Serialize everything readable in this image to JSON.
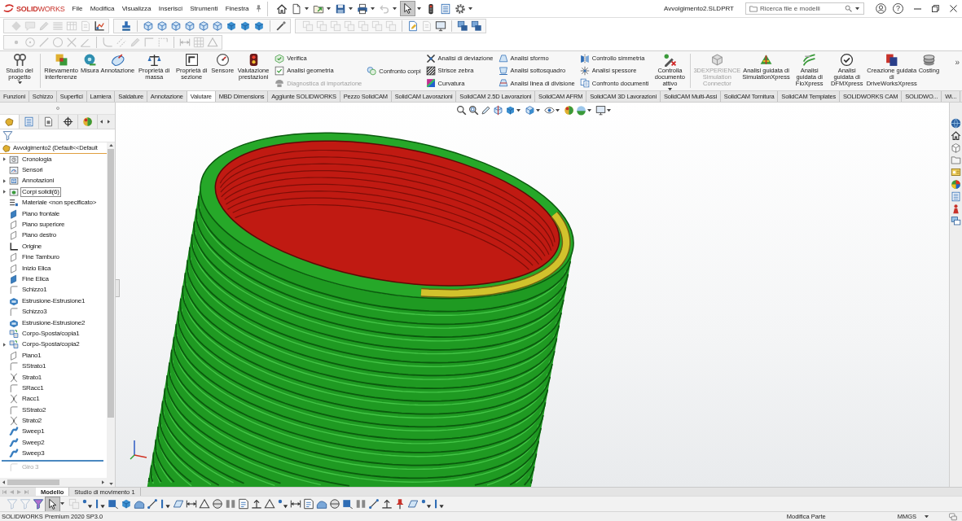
{
  "title_bar": {
    "logo": "**SOLID**WORKS",
    "menu": [
      "File",
      "Modifica",
      "Visualizza",
      "Inserisci",
      "Strumenti",
      "Finestra"
    ],
    "quick_access": [
      {
        "kind": "home",
        "menu": false,
        "disabled": false,
        "pressed": false
      },
      {
        "kind": "new",
        "menu": true,
        "disabled": false,
        "pressed": false
      },
      {
        "kind": "open",
        "menu": true,
        "disabled": false,
        "pressed": false
      },
      {
        "kind": "save",
        "menu": true,
        "disabled": false,
        "pressed": false
      },
      {
        "kind": "print",
        "menu": true,
        "disabled": false,
        "pressed": false
      },
      {
        "kind": "undo",
        "menu": true,
        "disabled": true,
        "pressed": false
      },
      {
        "kind": "select",
        "menu": true,
        "disabled": false,
        "pressed": true
      },
      {
        "kind": "rebuild",
        "menu": false,
        "disabled": false,
        "pressed": false
      },
      {
        "kind": "file-properties",
        "menu": false,
        "disabled": false,
        "pressed": false
      },
      {
        "kind": "options",
        "menu": true,
        "disabled": false,
        "pressed": false
      }
    ],
    "document_title": "Avvolgimento2.SLDPRT",
    "search": {
      "placeholder": "Ricerca file e modelli"
    },
    "help": "?"
  },
  "toolbars": [
    [
      {
        "sections": [
          [
            {
              "kind": "diamond",
              "disabled": true
            },
            {
              "kind": "comment",
              "disabled": true
            },
            {
              "kind": "pencil",
              "disabled": true
            },
            {
              "kind": "lines",
              "disabled": true
            },
            {
              "kind": "table",
              "disabled": true
            },
            {
              "kind": "page",
              "disabled": true
            },
            {
              "kind": "axes",
              "disabled": false
            }
          ]
        ]
      },
      {
        "sections": [
          [
            {
              "kind": "stamp",
              "disabled": false
            }
          ],
          [
            {
              "kind": "cube-wire",
              "disabled": false
            },
            {
              "kind": "cube-wire",
              "disabled": false
            },
            {
              "kind": "cube-wire",
              "disabled": false
            },
            {
              "kind": "cube-wire",
              "disabled": false
            },
            {
              "kind": "cube-wire",
              "disabled": false
            },
            {
              "kind": "cube-wire",
              "disabled": false
            },
            {
              "kind": "cube",
              "disabled": false
            },
            {
              "kind": "cube",
              "disabled": false
            },
            {
              "kind": "cube",
              "disabled": false
            }
          ],
          [
            {
              "kind": "wand",
              "disabled": false
            }
          ]
        ]
      },
      {
        "sections": [
          [
            {
              "kind": "squares",
              "disabled": true
            },
            {
              "kind": "squares",
              "disabled": true
            },
            {
              "kind": "squares",
              "disabled": true
            },
            {
              "kind": "squares",
              "disabled": true
            },
            {
              "kind": "squares",
              "disabled": true
            },
            {
              "kind": "squares",
              "disabled": true
            },
            {
              "kind": "squares",
              "disabled": true
            }
          ],
          [
            {
              "kind": "doc-edit",
              "disabled": false
            },
            {
              "kind": "page",
              "disabled": true
            },
            {
              "kind": "monitor",
              "disabled": false
            }
          ],
          [
            {
              "kind": "windows",
              "disabled": false
            },
            {
              "kind": "windows",
              "disabled": false
            }
          ]
        ]
      }
    ],
    [
      {
        "sections": [
          [
            {
              "kind": "point",
              "disabled": true
            },
            {
              "kind": "circle-target",
              "disabled": true
            },
            {
              "kind": "line",
              "disabled": true
            },
            {
              "kind": "circle",
              "disabled": true
            },
            {
              "kind": "trim",
              "disabled": true
            },
            {
              "kind": "angle-line",
              "disabled": true
            }
          ],
          [
            {
              "kind": "fillet",
              "disabled": true
            },
            {
              "kind": "offset",
              "disabled": true
            },
            {
              "kind": "pencil",
              "disabled": true
            },
            {
              "kind": "corner",
              "disabled": true
            },
            {
              "kind": "corner-dashed",
              "disabled": true
            }
          ],
          [
            {
              "kind": "dimension",
              "disabled": true
            },
            {
              "kind": "grid",
              "disabled": true
            },
            {
              "kind": "triangle",
              "disabled": true
            }
          ]
        ]
      }
    ]
  ],
  "ribbon": {
    "groups": [
      [
        {
          "kind": "large",
          "item": {
            "kind": "tools",
            "label": "Studio del progetto",
            "menu": true,
            "disabled": false
          }
        }
      ],
      [
        {
          "kind": "large",
          "item": {
            "kind": "interference",
            "label": "Rilevamento interferenze",
            "menu": false,
            "disabled": false
          }
        },
        {
          "kind": "large",
          "item": {
            "kind": "measure",
            "label": "Misura",
            "menu": false,
            "disabled": false
          }
        },
        {
          "kind": "large",
          "item": {
            "kind": "annotation",
            "label": "Annotazione",
            "menu": false,
            "disabled": false
          }
        },
        {
          "kind": "large",
          "item": {
            "kind": "mass-properties",
            "label": "Proprietà di massa",
            "menu": false,
            "disabled": false
          }
        },
        {
          "kind": "large",
          "item": {
            "kind": "section-properties",
            "label": "Proprietà di sezione",
            "menu": false,
            "disabled": false
          }
        },
        {
          "kind": "large",
          "item": {
            "kind": "sensor",
            "label": "Sensore",
            "menu": false,
            "disabled": false
          }
        },
        {
          "kind": "large",
          "item": {
            "kind": "performance",
            "label": "Valutazione prestazioni",
            "menu": false,
            "disabled": false
          }
        },
        {
          "kind": "stack",
          "items": [
            {
              "kind": "verify",
              "label": "Verifica",
              "disabled": false
            },
            {
              "kind": "geometry",
              "label": "Analisi geometria",
              "disabled": false
            },
            {
              "kind": "import-diagnostics",
              "label": "Diagnostica di importazione",
              "disabled": true
            }
          ]
        },
        {
          "kind": "stack",
          "items": [
            {
              "kind": "compare-bodies",
              "label": "Confronto corpi",
              "disabled": false
            }
          ]
        },
        {
          "kind": "stack",
          "items": [
            {
              "kind": "deviation",
              "label": "Analisi di deviazione",
              "disabled": false
            },
            {
              "kind": "zebra",
              "label": "Strisce zebra",
              "disabled": false
            },
            {
              "kind": "curvature",
              "label": "Curvatura",
              "disabled": false
            }
          ]
        },
        {
          "kind": "stack",
          "items": [
            {
              "kind": "draft",
              "label": "Analisi sformo",
              "disabled": false
            },
            {
              "kind": "undercut",
              "label": "Analisi sottosquadro",
              "disabled": false
            },
            {
              "kind": "parting-line",
              "label": "Analisi linea di divisione",
              "disabled": false
            }
          ]
        },
        {
          "kind": "stack",
          "items": [
            {
              "kind": "symmetry",
              "label": "Controllo simmetria",
              "disabled": false
            },
            {
              "kind": "thickness",
              "label": "Analisi spessore",
              "disabled": false
            },
            {
              "kind": "compare-documents",
              "label": "Confronto documenti",
              "disabled": false
            }
          ]
        },
        {
          "kind": "large",
          "item": {
            "kind": "design-checker",
            "label": "Controlla documento attivo",
            "menu": true,
            "disabled": false
          }
        }
      ],
      [
        {
          "kind": "large",
          "item": {
            "kind": "connector",
            "label": "3DEXPERIENCE Simulation Connector",
            "menu": false,
            "disabled": true
          }
        },
        {
          "kind": "large",
          "item": {
            "kind": "simulationxpress",
            "label": "Analisi guidata di SimulationXpress",
            "menu": false,
            "disabled": false
          }
        },
        {
          "kind": "large",
          "item": {
            "kind": "floxpress",
            "label": "Analisi guidata di FloXpress",
            "menu": false,
            "disabled": false
          }
        },
        {
          "kind": "large",
          "item": {
            "kind": "dfmxpress",
            "label": "Analisi guidata di DFMXpress",
            "menu": false,
            "disabled": false
          }
        },
        {
          "kind": "large",
          "item": {
            "kind": "driveworksxpress",
            "label": "Creazione guidata di DriveWorksXpress",
            "menu": false,
            "disabled": false
          }
        },
        {
          "kind": "large",
          "item": {
            "kind": "costing",
            "label": "Costing",
            "menu": false,
            "disabled": false
          }
        }
      ]
    ],
    "more": "»"
  },
  "command_tabs": [
    {
      "label": "Funzioni",
      "selected": false
    },
    {
      "label": "Schizzo",
      "selected": false
    },
    {
      "label": "Superfici",
      "selected": false
    },
    {
      "label": "Lamiera",
      "selected": false
    },
    {
      "label": "Saldature",
      "selected": false
    },
    {
      "label": "Annotazione",
      "selected": false
    },
    {
      "label": "Valutare",
      "selected": true
    },
    {
      "label": "MBD Dimensions",
      "selected": false
    },
    {
      "label": "Aggiunte SOLIDWORKS",
      "selected": false
    },
    {
      "label": "Pezzo SolidCAM",
      "selected": false
    },
    {
      "label": "SolidCAM Lavorazioni",
      "selected": false
    },
    {
      "label": "SolidCAM 2.5D Lavorazioni",
      "selected": false
    },
    {
      "label": "SolidCAM AFRM",
      "selected": false
    },
    {
      "label": "SolidCAM 3D Lavorazioni",
      "selected": false
    },
    {
      "label": "SolidCAM Multi-Assi",
      "selected": false
    },
    {
      "label": "SolidCAM Tornitura",
      "selected": false
    },
    {
      "label": "SolidCAM Templates",
      "selected": false
    },
    {
      "label": "SOLIDWORKS CAM",
      "selected": false
    },
    {
      "label": "SOLIDWO...",
      "selected": false
    },
    {
      "label": "Wi...",
      "selected": false
    }
  ],
  "feature_tree": {
    "tabs": [
      {
        "kind": "feature-manager",
        "selected": true
      },
      {
        "kind": "property-manager",
        "selected": false
      },
      {
        "kind": "configuration-manager",
        "selected": false
      },
      {
        "kind": "dimxpert",
        "selected": false
      },
      {
        "kind": "display-manager",
        "selected": false
      }
    ],
    "root": "Avvolgimento2 (Default<<Default",
    "items": [
      {
        "kind": "history",
        "label": "Cronologia",
        "expandable": true,
        "selected": false,
        "rolled_back": false
      },
      {
        "kind": "sensors",
        "label": "Sensori",
        "expandable": false,
        "selected": false,
        "rolled_back": false
      },
      {
        "kind": "annotations",
        "label": "Annotazioni",
        "expandable": true,
        "selected": false,
        "rolled_back": false
      },
      {
        "kind": "bodies",
        "label": "Corpi solidi(6)",
        "expandable": true,
        "selected": true,
        "rolled_back": false
      },
      {
        "kind": "material",
        "label": "Materiale <non specificato>",
        "expandable": false,
        "selected": false,
        "rolled_back": false
      },
      {
        "kind": "plane-filled",
        "label": "Piano frontale",
        "expandable": false,
        "selected": false,
        "rolled_back": false
      },
      {
        "kind": "plane",
        "label": "Piano superiore",
        "expandable": false,
        "selected": false,
        "rolled_back": false
      },
      {
        "kind": "plane",
        "label": "Piano destro",
        "expandable": false,
        "selected": false,
        "rolled_back": false
      },
      {
        "kind": "origin",
        "label": "Origine",
        "expandable": false,
        "selected": false,
        "rolled_back": false
      },
      {
        "kind": "plane",
        "label": "Fine Tamburo",
        "expandable": false,
        "selected": false,
        "rolled_back": false
      },
      {
        "kind": "plane",
        "label": "Inizio Elica",
        "expandable": false,
        "selected": false,
        "rolled_back": false
      },
      {
        "kind": "plane-filled",
        "label": "Fine Elica",
        "expandable": false,
        "selected": false,
        "rolled_back": false
      },
      {
        "kind": "sketch",
        "label": "Schizzo1",
        "expandable": false,
        "selected": false,
        "rolled_back": false
      },
      {
        "kind": "extrude",
        "label": "Estrusione-Estrusione1",
        "expandable": false,
        "selected": false,
        "rolled_back": false
      },
      {
        "kind": "sketch",
        "label": "Schizzo3",
        "expandable": false,
        "selected": false,
        "rolled_back": false
      },
      {
        "kind": "extrude",
        "label": "Estrusione-Estrusione2",
        "expandable": false,
        "selected": false,
        "rolled_back": false
      },
      {
        "kind": "move-body",
        "label": "Corpo-Sposta/copia1",
        "expandable": false,
        "selected": false,
        "rolled_back": false
      },
      {
        "kind": "move-body",
        "label": "Corpo-Sposta/copia2",
        "expandable": true,
        "selected": false,
        "rolled_back": false
      },
      {
        "kind": "plane",
        "label": "Piano1",
        "expandable": false,
        "selected": false,
        "rolled_back": false
      },
      {
        "kind": "sketch",
        "label": "SStrato1",
        "expandable": false,
        "selected": false,
        "rolled_back": false
      },
      {
        "kind": "loft",
        "label": "Strato1",
        "expandable": false,
        "selected": false,
        "rolled_back": false
      },
      {
        "kind": "sketch",
        "label": "SRacc1",
        "expandable": false,
        "selected": false,
        "rolled_back": false
      },
      {
        "kind": "loft",
        "label": "Racc1",
        "expandable": false,
        "selected": false,
        "rolled_back": false
      },
      {
        "kind": "sketch",
        "label": "SStrato2",
        "expandable": false,
        "selected": false,
        "rolled_back": false
      },
      {
        "kind": "loft",
        "label": "Strato2",
        "expandable": false,
        "selected": false,
        "rolled_back": false
      },
      {
        "kind": "sweep",
        "label": "Sweep1",
        "expandable": false,
        "selected": false,
        "rolled_back": false
      },
      {
        "kind": "sweep",
        "label": "Sweep2",
        "expandable": false,
        "selected": false,
        "rolled_back": false
      },
      {
        "kind": "sweep",
        "label": "Sweep3",
        "expandable": false,
        "selected": false,
        "rolled_back": false
      },
      {
        "kind": "sketch",
        "label": "Giro 3",
        "expandable": false,
        "selected": false,
        "rolled_back": true
      }
    ]
  },
  "view_toolbar": [
    {
      "kind": "zoom-fit",
      "menu": false
    },
    {
      "kind": "zoom-area",
      "menu": false
    },
    {
      "kind": "previous-view",
      "menu": false
    },
    {
      "kind": "section-view",
      "menu": false
    },
    {
      "kind": "view-orientation",
      "menu": true
    },
    {
      "kind": "display-style",
      "menu": true
    },
    {
      "kind": "hide-show",
      "menu": true
    },
    {
      "kind": "appearance",
      "menu": false
    },
    {
      "kind": "scene",
      "menu": true
    },
    {
      "kind": "view-settings",
      "menu": true
    }
  ],
  "task_pane": [
    {
      "kind": "globe"
    },
    {
      "kind": "home"
    },
    {
      "kind": "box"
    },
    {
      "kind": "folder"
    },
    {
      "kind": "card"
    },
    {
      "kind": "color-wheel"
    },
    {
      "kind": "list"
    },
    {
      "kind": "figure"
    },
    {
      "kind": "chat"
    }
  ],
  "bottom_tabs": [
    {
      "label": "Modello",
      "selected": true
    },
    {
      "label": "Studio di movimento 1",
      "selected": false
    }
  ],
  "selection_toolbar": [
    {
      "kind": "filter",
      "disabled": true,
      "pressed": false,
      "menu": false
    },
    {
      "kind": "filter",
      "disabled": true,
      "pressed": false,
      "menu": false
    },
    {
      "kind": "filter-color",
      "disabled": false,
      "pressed": false,
      "menu": false
    },
    {
      "kind": "select",
      "disabled": false,
      "pressed": true,
      "menu": true
    },
    {
      "kind": "squares",
      "disabled": true,
      "pressed": false,
      "menu": false
    },
    {
      "kind": "sel-point",
      "disabled": false,
      "pressed": false,
      "menu": false
    },
    {
      "kind": "sel-edge",
      "disabled": false,
      "pressed": false,
      "menu": false
    },
    {
      "kind": "sel-face",
      "disabled": false,
      "pressed": false,
      "menu": false
    },
    {
      "kind": "cube",
      "disabled": false,
      "pressed": false,
      "menu": false
    },
    {
      "kind": "sel-surface",
      "disabled": false,
      "pressed": false,
      "menu": false
    },
    {
      "kind": "sel-segment",
      "disabled": false,
      "pressed": false,
      "menu": false
    },
    {
      "kind": "sel-edge",
      "disabled": false,
      "pressed": false,
      "menu": false
    },
    {
      "kind": "sel-plane",
      "disabled": false,
      "pressed": false,
      "menu": false
    },
    {
      "kind": "dimension",
      "disabled": false,
      "pressed": false,
      "menu": false
    },
    {
      "kind": "triangle",
      "disabled": false,
      "pressed": false,
      "menu": false
    },
    {
      "kind": "sel-split",
      "disabled": false,
      "pressed": false,
      "menu": false
    },
    {
      "kind": "sel-bars",
      "disabled": false,
      "pressed": false,
      "menu": false
    },
    {
      "kind": "note",
      "disabled": false,
      "pressed": false,
      "menu": false
    },
    {
      "kind": "sel-weld",
      "disabled": false,
      "pressed": false,
      "menu": false
    },
    {
      "kind": "triangle",
      "disabled": false,
      "pressed": false,
      "menu": false
    },
    {
      "kind": "sel-point",
      "disabled": false,
      "pressed": false,
      "menu": false
    },
    {
      "kind": "dimension",
      "disabled": false,
      "pressed": false,
      "menu": false
    },
    {
      "kind": "note",
      "disabled": false,
      "pressed": false,
      "menu": false
    },
    {
      "kind": "sel-surface",
      "disabled": false,
      "pressed": false,
      "menu": false
    },
    {
      "kind": "sel-split",
      "disabled": false,
      "pressed": false,
      "menu": false
    },
    {
      "kind": "sel-face",
      "disabled": false,
      "pressed": false,
      "menu": false
    },
    {
      "kind": "sel-bars",
      "disabled": false,
      "pressed": false,
      "menu": false
    },
    {
      "kind": "sel-segment",
      "disabled": false,
      "pressed": false,
      "menu": false
    },
    {
      "kind": "sel-weld",
      "disabled": false,
      "pressed": false,
      "menu": false
    },
    {
      "kind": "sel-pin",
      "disabled": false,
      "pressed": false,
      "menu": false
    },
    {
      "kind": "sel-plane",
      "disabled": false,
      "pressed": false,
      "menu": false
    },
    {
      "kind": "sel-point",
      "disabled": false,
      "pressed": false,
      "menu": false
    },
    {
      "kind": "sel-edge",
      "disabled": false,
      "pressed": false,
      "menu": false
    }
  ],
  "status_bar": {
    "product": "SOLIDWORKS Premium 2020 SP3.0",
    "mode": "Modifica Parte",
    "units": "MMGS"
  }
}
